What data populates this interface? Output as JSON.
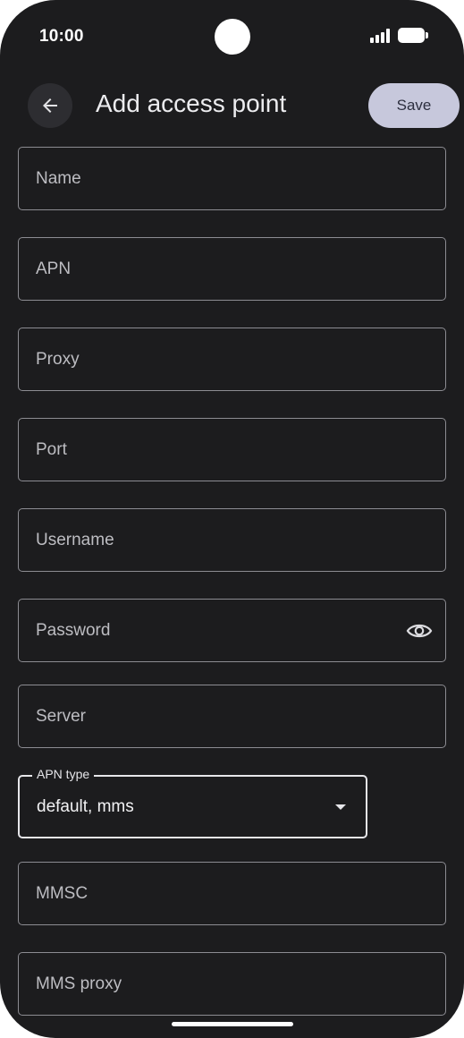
{
  "status_bar": {
    "time": "10:00"
  },
  "app_bar": {
    "title": "Add access point",
    "save_label": "Save"
  },
  "fields": [
    {
      "id": "name",
      "placeholder": "Name"
    },
    {
      "id": "apn",
      "placeholder": "APN"
    },
    {
      "id": "proxy",
      "placeholder": "Proxy"
    },
    {
      "id": "port",
      "placeholder": "Port"
    },
    {
      "id": "username",
      "placeholder": "Username"
    },
    {
      "id": "password",
      "placeholder": "Password",
      "trailing_icon": "eye-icon"
    },
    {
      "id": "server",
      "placeholder": "Server"
    },
    {
      "id": "mmsc",
      "placeholder": "MMSC"
    },
    {
      "id": "mms_proxy",
      "placeholder": "MMS proxy"
    }
  ],
  "apn_type": {
    "label": "APN type",
    "value": "default, mms",
    "icon": "dropdown-arrow-icon"
  },
  "icons": {
    "back": "arrow-left-icon",
    "signal": "signal-icon",
    "battery": "battery-icon"
  }
}
